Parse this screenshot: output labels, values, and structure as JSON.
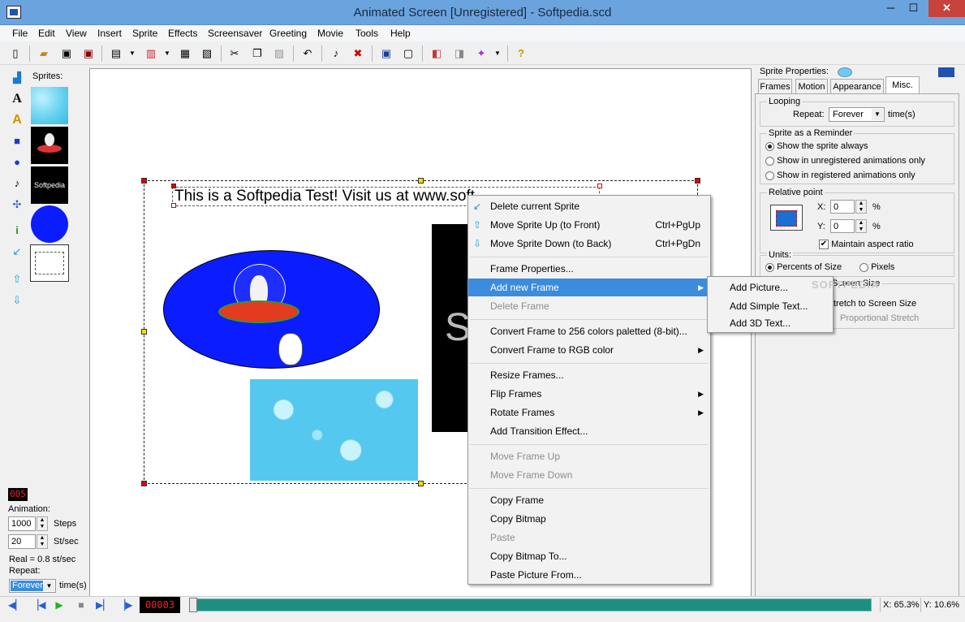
{
  "window": {
    "title": "Animated Screen [Unregistered] - Softpedia.scd",
    "minimize": "─",
    "maximize": "☐",
    "close": "✕"
  },
  "menubar": [
    "File",
    "Edit",
    "View",
    "Insert",
    "Sprite",
    "Effects",
    "Screensaver",
    "Greeting",
    "Movie",
    "Tools",
    "Help"
  ],
  "sprites_panel": {
    "label": "Sprites:",
    "thumb_text": "Softpedia"
  },
  "animation": {
    "counter": "005",
    "label": "Animation:",
    "steps_value": "1000",
    "steps_unit": "Steps",
    "rate_value": "20",
    "rate_unit": "St/sec",
    "real": "Real = 0.8 st/sec",
    "repeat_label": "Repeat:",
    "repeat_value": "Forever",
    "repeat_unit": "time(s)"
  },
  "canvas": {
    "banner_text": "This is a Softpedia Test! Visit us at www.softpedia.com",
    "big_letter": "S"
  },
  "context_menu": [
    {
      "label": "Delete current Sprite",
      "shortcut": "",
      "submenu": false,
      "disabled": false,
      "icon": "delete-sprite-icon"
    },
    {
      "label": "Move Sprite Up (to Front)",
      "shortcut": "Ctrl+PgUp",
      "submenu": false,
      "disabled": false,
      "icon": "arrow-up-icon"
    },
    {
      "label": "Move Sprite Down (to Back)",
      "shortcut": "Ctrl+PgDn",
      "submenu": false,
      "disabled": false,
      "icon": "arrow-down-icon"
    },
    {
      "sep": true
    },
    {
      "label": "Frame Properties...",
      "disabled": false
    },
    {
      "label": "Add new Frame",
      "submenu": true,
      "highlighted": true
    },
    {
      "label": "Delete Frame",
      "disabled": true
    },
    {
      "sep": true
    },
    {
      "label": "Convert Frame to 256 colors paletted (8-bit)...",
      "disabled": false
    },
    {
      "label": "Convert Frame to RGB color",
      "submenu": true
    },
    {
      "sep": true
    },
    {
      "label": "Resize Frames..."
    },
    {
      "label": "Flip Frames",
      "submenu": true
    },
    {
      "label": "Rotate Frames",
      "submenu": true
    },
    {
      "label": "Add Transition Effect..."
    },
    {
      "sep": true
    },
    {
      "label": "Move Frame Up",
      "disabled": true
    },
    {
      "label": "Move Frame Down",
      "disabled": true
    },
    {
      "sep": true
    },
    {
      "label": "Copy Frame"
    },
    {
      "label": "Copy Bitmap"
    },
    {
      "label": "Paste",
      "disabled": true
    },
    {
      "label": "Copy Bitmap To..."
    },
    {
      "label": "Paste Picture From..."
    }
  ],
  "submenu": [
    "Add Picture...",
    "Add Simple Text...",
    "Add 3D Text..."
  ],
  "properties": {
    "header": "Sprite Properties:",
    "tabs": [
      "Frames",
      "Motion",
      "Appearance",
      "Misc."
    ],
    "looping": {
      "legend": "Looping",
      "repeat_label": "Repeat:",
      "repeat_value": "Forever",
      "unit": "time(s)"
    },
    "reminder": {
      "legend": "Sprite as a Reminder",
      "options": [
        "Show the sprite always",
        "Show in unregistered animations only",
        "Show in registered animations only"
      ]
    },
    "relative": {
      "legend": "Relative point",
      "x_label": "X:",
      "x_value": "0",
      "y_label": "Y:",
      "y_value": "0",
      "pct": "%",
      "aspect": "Maintain aspect ratio"
    },
    "units": {
      "legend": "Units:",
      "percent": "Percents of Size",
      "pixels": "Pixels"
    },
    "screen": {
      "legend": "Screen Size",
      "stretch": "tretch to Screen Size",
      "proportional": "Proportional Stretch"
    }
  },
  "status": {
    "frame": "00003",
    "x": "X: 65.3%",
    "y": "Y: 10.6%"
  },
  "watermark": "SOFTPEDIA"
}
